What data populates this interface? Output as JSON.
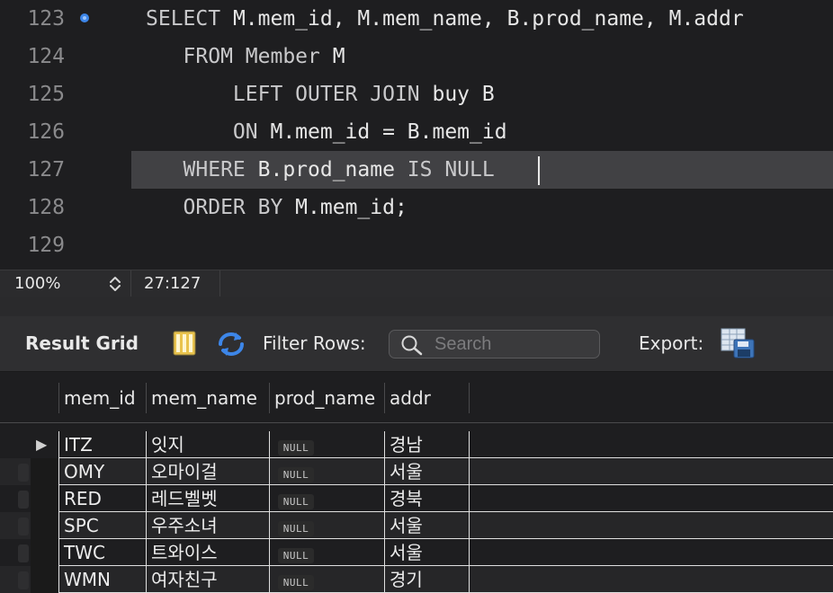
{
  "editor": {
    "lines": [
      {
        "num": "123",
        "segments": [
          {
            "t": "SELECT",
            "kw": true
          },
          {
            "t": " M.mem_id, M.mem_name, B.prod_name, M.addr",
            "kw": false
          }
        ]
      },
      {
        "num": "124",
        "segments": [
          {
            "t": "   FROM",
            "kw": true
          },
          {
            "t": " ",
            "kw": false
          },
          {
            "t": "Member",
            "kw": true
          },
          {
            "t": " M",
            "kw": false
          }
        ]
      },
      {
        "num": "125",
        "segments": [
          {
            "t": "       LEFT OUTER JOIN",
            "kw": true
          },
          {
            "t": " buy B",
            "kw": false
          }
        ]
      },
      {
        "num": "126",
        "segments": [
          {
            "t": "       ON",
            "kw": true
          },
          {
            "t": " M.mem_id = B.mem_id",
            "kw": false
          }
        ]
      },
      {
        "num": "127",
        "segments": [
          {
            "t": "   WHERE",
            "kw": true
          },
          {
            "t": " B.prod_name ",
            "kw": false
          },
          {
            "t": "IS NULL",
            "kw": true
          }
        ]
      },
      {
        "num": "128",
        "segments": [
          {
            "t": "   ORDER BY",
            "kw": true
          },
          {
            "t": " M.mem_id;",
            "kw": false
          }
        ]
      },
      {
        "num": "129",
        "segments": []
      }
    ]
  },
  "status": {
    "zoom": "100%",
    "cursor_position": "27:127"
  },
  "toolbar": {
    "title": "Result Grid",
    "filter_label": "Filter Rows:",
    "search_placeholder": "Search",
    "export_label": "Export:"
  },
  "grid": {
    "columns": [
      "mem_id",
      "mem_name",
      "prod_name",
      "addr"
    ],
    "rows": [
      {
        "mem_id": "ITZ",
        "mem_name": "잇지",
        "prod_name": "NULL",
        "addr": "경남",
        "selected": true
      },
      {
        "mem_id": "OMY",
        "mem_name": "오마이걸",
        "prod_name": "NULL",
        "addr": "서울"
      },
      {
        "mem_id": "RED",
        "mem_name": "레드벨벳",
        "prod_name": "NULL",
        "addr": "경북"
      },
      {
        "mem_id": "SPC",
        "mem_name": "우주소녀",
        "prod_name": "NULL",
        "addr": "서울"
      },
      {
        "mem_id": "TWC",
        "mem_name": "트와이스",
        "prod_name": "NULL",
        "addr": "서울"
      },
      {
        "mem_id": "WMN",
        "mem_name": "여자친구",
        "prod_name": "NULL",
        "addr": "경기"
      }
    ]
  },
  "icons": {
    "line_marker": "breakpoint-dot-icon",
    "grid_layout": "grid-layout-icon",
    "refresh": "refresh-arrows-icon",
    "search": "search-icon",
    "export": "export-save-icon",
    "zoom_stepper": "up-down-stepper-icon",
    "row_indicator": "current-row-arrow-icon"
  },
  "colors": {
    "accent_blue": "#3d86e8",
    "grid_lines": "#e0e0e0",
    "editor_bg": "#1e1e20"
  }
}
